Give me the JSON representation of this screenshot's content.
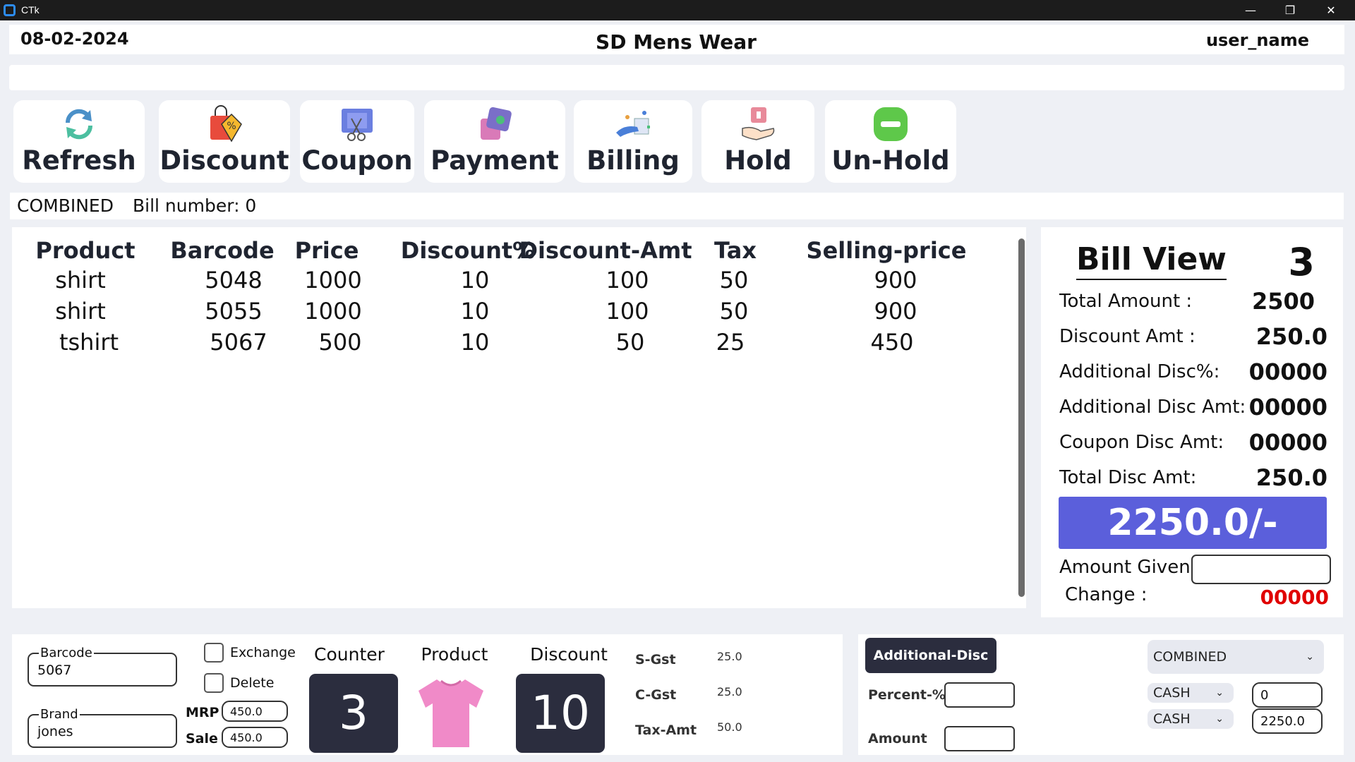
{
  "window": {
    "title": "CTk",
    "minimize": "—",
    "maximize": "❐",
    "close": "✕"
  },
  "header": {
    "date": "08-02-2024",
    "shop_name": "SD Mens Wear",
    "user": "user_name"
  },
  "toolbar": [
    {
      "label": "Refresh",
      "icon": "refresh-icon"
    },
    {
      "label": "Discount",
      "icon": "discount-bag-icon"
    },
    {
      "label": "Coupon",
      "icon": "coupon-scissors-icon"
    },
    {
      "label": "Payment",
      "icon": "payment-card-icon"
    },
    {
      "label": "Billing",
      "icon": "billing-hand-icon"
    },
    {
      "label": "Hold",
      "icon": "hold-hand-icon"
    },
    {
      "label": "Un-Hold",
      "icon": "minus-circle-icon"
    }
  ],
  "info_strip": {
    "mode": "COMBINED",
    "bill_number_label": "Bill number: 0"
  },
  "table": {
    "columns": [
      "Product",
      "Barcode",
      "Price",
      "Discount%",
      "Discount-Amt",
      "Tax",
      "Selling-price"
    ],
    "rows": [
      [
        "shirt",
        "5048",
        "1000",
        "10",
        "100",
        "50",
        "900"
      ],
      [
        "shirt",
        "5055",
        "1000",
        "10",
        "100",
        "50",
        "900"
      ],
      [
        "tshirt",
        "5067",
        "500",
        "10",
        "50",
        "25",
        "450"
      ]
    ]
  },
  "bill_view": {
    "title": "Bill View",
    "count": "3",
    "lines": [
      {
        "label": "Total Amount :",
        "value": "2500"
      },
      {
        "label": "Discount Amt :",
        "value": "250.0"
      },
      {
        "label": "Additional Disc%:",
        "value": "00000"
      },
      {
        "label": "Additional Disc Amt:",
        "value": "00000"
      },
      {
        "label": "Coupon Disc Amt:",
        "value": "00000"
      },
      {
        "label": "Total Disc Amt:",
        "value": "250.0"
      }
    ],
    "total": "2250.0/-",
    "amount_given_label": "Amount Given:",
    "change_label": "Change :",
    "change_value": "00000",
    "change_color": "#e00000",
    "total_color": "#5b5fdb"
  },
  "entry": {
    "barcode_legend": "Barcode",
    "barcode_value": "5067",
    "brand_legend": "Brand",
    "brand_value": "jones",
    "exchange_label": "Exchange",
    "delete_label": "Delete",
    "mrp_label": "MRP",
    "mrp_value": "450.0",
    "sale_label": "Sale",
    "sale_value": "450.0",
    "counter_label": "Counter",
    "counter_value": "3",
    "product_label": "Product",
    "product_icon": "pink-tshirt-icon",
    "discount_label": "Discount",
    "discount_value": "10",
    "sgst_label": "S-Gst",
    "sgst_value": "25.0",
    "cgst_label": "C-Gst",
    "cgst_value": "25.0",
    "taxamt_label": "Tax-Amt",
    "taxamt_value": "50.0"
  },
  "payment": {
    "additional_disc_button": "Additional-Disc",
    "percent_label": "Percent-%",
    "amount_label": "Amount",
    "mode_select": "COMBINED",
    "method1": "CASH",
    "method1_amount": "0",
    "method2": "CASH",
    "method2_amount": "2250.0"
  }
}
